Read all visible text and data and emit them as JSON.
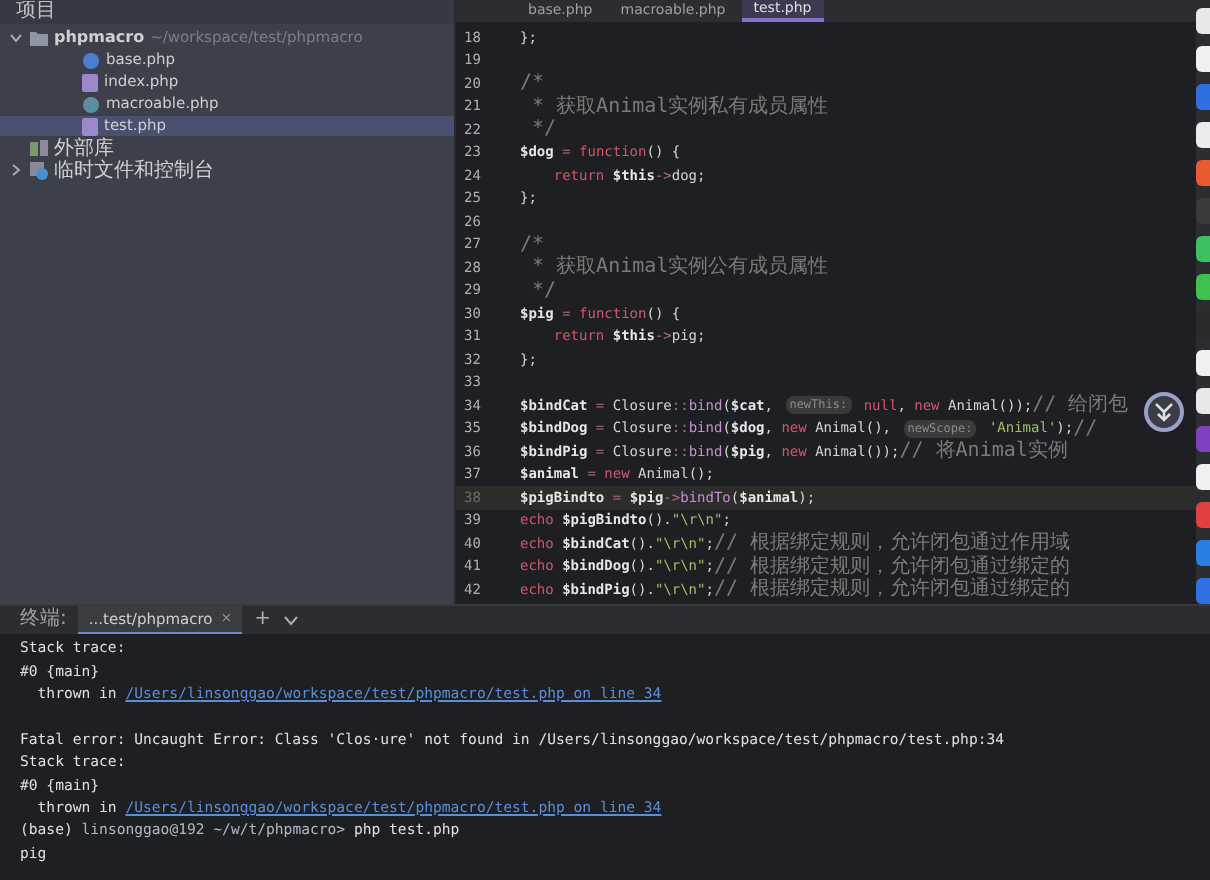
{
  "tool_window": {
    "title": "项目"
  },
  "project_tree": [
    {
      "label": "phpmacro",
      "path": "~/workspace/test/phpmacro",
      "kind": "folder",
      "expanded": true,
      "selected": false,
      "children": [
        {
          "label": "base.php",
          "kind": "class",
          "selected": false
        },
        {
          "label": "index.php",
          "kind": "php",
          "selected": false
        },
        {
          "label": "macroable.php",
          "kind": "trait",
          "selected": false
        },
        {
          "label": "test.php",
          "kind": "php",
          "selected": true
        }
      ]
    },
    {
      "label": "外部库",
      "kind": "library",
      "selected": false
    },
    {
      "label": "临时文件和控制台",
      "kind": "scratch",
      "expanded": false,
      "selected": false
    }
  ],
  "editor_tabs": [
    {
      "label": "base.php",
      "selected": false
    },
    {
      "label": "macroable.php",
      "selected": false
    },
    {
      "label": "test.php",
      "selected": true
    }
  ],
  "editor_lines": [
    {
      "number": "18",
      "current": false,
      "tokens": [
        {
          "kind": "p",
          "text": "};"
        }
      ]
    },
    {
      "number": "19",
      "current": false
    },
    {
      "number": "20",
      "current": false,
      "tokens": [
        {
          "kind": "c",
          "text": "/*"
        }
      ]
    },
    {
      "number": "21",
      "current": false,
      "tokens": [
        {
          "kind": "c",
          "text": " * 获取Animal实例私有成员属性"
        }
      ]
    },
    {
      "number": "22",
      "current": false,
      "tokens": [
        {
          "kind": "c",
          "text": " */"
        }
      ]
    },
    {
      "number": "23",
      "current": false,
      "tokens": [
        {
          "kind": "v",
          "text": "$dog"
        },
        {
          "kind": "o",
          "text": " = "
        },
        {
          "kind": "k",
          "text": "function"
        },
        {
          "kind": "p",
          "text": "() {"
        }
      ]
    },
    {
      "number": "24",
      "current": false,
      "tokens": [
        {
          "kind": "k",
          "text": "    return "
        },
        {
          "kind": "v",
          "text": "$this"
        },
        {
          "kind": "o",
          "text": "->"
        },
        {
          "kind": "p",
          "text": "dog;"
        }
      ]
    },
    {
      "number": "25",
      "current": false,
      "tokens": [
        {
          "kind": "p",
          "text": "};"
        }
      ]
    },
    {
      "number": "26",
      "current": false
    },
    {
      "number": "27",
      "current": false,
      "tokens": [
        {
          "kind": "c",
          "text": "/*"
        }
      ]
    },
    {
      "number": "28",
      "current": false,
      "tokens": [
        {
          "kind": "c",
          "text": " * 获取Animal实例公有成员属性"
        }
      ]
    },
    {
      "number": "29",
      "current": false,
      "tokens": [
        {
          "kind": "c",
          "text": " */"
        }
      ]
    },
    {
      "number": "30",
      "current": false,
      "tokens": [
        {
          "kind": "v",
          "text": "$pig"
        },
        {
          "kind": "o",
          "text": " = "
        },
        {
          "kind": "k",
          "text": "function"
        },
        {
          "kind": "p",
          "text": "() {"
        }
      ]
    },
    {
      "number": "31",
      "current": false,
      "tokens": [
        {
          "kind": "k",
          "text": "    return "
        },
        {
          "kind": "v",
          "text": "$this"
        },
        {
          "kind": "o",
          "text": "->"
        },
        {
          "kind": "p",
          "text": "pig;"
        }
      ]
    },
    {
      "number": "32",
      "current": false,
      "tokens": [
        {
          "kind": "p",
          "text": "};"
        }
      ]
    },
    {
      "number": "33",
      "current": false
    },
    {
      "number": "34",
      "current": false,
      "tokens": [
        {
          "kind": "v",
          "text": "$bindCat"
        },
        {
          "kind": "o",
          "text": " = "
        },
        {
          "kind": "p",
          "text": "Closure"
        },
        {
          "kind": "o",
          "text": "::"
        },
        {
          "kind": "f",
          "text": "bind"
        },
        {
          "kind": "p",
          "text": "("
        },
        {
          "kind": "v",
          "text": "$cat"
        },
        {
          "kind": "p",
          "text": ", "
        },
        {
          "kind": "h",
          "text": "newThis:"
        },
        {
          "kind": "k",
          "text": " null"
        },
        {
          "kind": "p",
          "text": ", "
        },
        {
          "kind": "k",
          "text": "new "
        },
        {
          "kind": "p",
          "text": "Animal());"
        },
        {
          "kind": "c",
          "text": "// 给闭包"
        }
      ]
    },
    {
      "number": "35",
      "current": false,
      "tokens": [
        {
          "kind": "v",
          "text": "$bindDog"
        },
        {
          "kind": "o",
          "text": " = "
        },
        {
          "kind": "p",
          "text": "Closure"
        },
        {
          "kind": "o",
          "text": "::"
        },
        {
          "kind": "f",
          "text": "bind"
        },
        {
          "kind": "p",
          "text": "("
        },
        {
          "kind": "v",
          "text": "$dog"
        },
        {
          "kind": "p",
          "text": ", "
        },
        {
          "kind": "k",
          "text": "new "
        },
        {
          "kind": "p",
          "text": "Animal(), "
        },
        {
          "kind": "h",
          "text": "newScope:"
        },
        {
          "kind": "s",
          "text": " 'Animal'"
        },
        {
          "kind": "p",
          "text": ");"
        },
        {
          "kind": "c",
          "text": "//"
        }
      ]
    },
    {
      "number": "36",
      "current": false,
      "tokens": [
        {
          "kind": "v",
          "text": "$bindPig"
        },
        {
          "kind": "o",
          "text": " = "
        },
        {
          "kind": "p",
          "text": "Closure"
        },
        {
          "kind": "o",
          "text": "::"
        },
        {
          "kind": "f",
          "text": "bind"
        },
        {
          "kind": "p",
          "text": "("
        },
        {
          "kind": "v",
          "text": "$pig"
        },
        {
          "kind": "p",
          "text": ", "
        },
        {
          "kind": "k",
          "text": "new "
        },
        {
          "kind": "p",
          "text": "Animal());"
        },
        {
          "kind": "c",
          "text": "// 将Animal实例"
        }
      ]
    },
    {
      "number": "37",
      "current": false,
      "tokens": [
        {
          "kind": "v",
          "text": "$animal"
        },
        {
          "kind": "o",
          "text": " = "
        },
        {
          "kind": "k",
          "text": "new "
        },
        {
          "kind": "p",
          "text": "Animal();"
        }
      ]
    },
    {
      "number": "38",
      "current": true,
      "tokens": [
        {
          "kind": "v",
          "text": "$pigBindto"
        },
        {
          "kind": "o",
          "text": " = "
        },
        {
          "kind": "v",
          "text": "$pig"
        },
        {
          "kind": "o",
          "text": "->"
        },
        {
          "kind": "f",
          "text": "bindTo"
        },
        {
          "kind": "p",
          "text": "("
        },
        {
          "kind": "v",
          "text": "$animal"
        },
        {
          "kind": "p",
          "text": ");"
        }
      ]
    },
    {
      "number": "39",
      "current": false,
      "tokens": [
        {
          "kind": "k",
          "text": "echo "
        },
        {
          "kind": "v",
          "text": "$pigBindto"
        },
        {
          "kind": "p",
          "text": "()."
        },
        {
          "kind": "s",
          "text": "\"\\r\\n\""
        },
        {
          "kind": "p",
          "text": ";"
        }
      ]
    },
    {
      "number": "40",
      "current": false,
      "tokens": [
        {
          "kind": "k",
          "text": "echo "
        },
        {
          "kind": "v",
          "text": "$bindCat"
        },
        {
          "kind": "p",
          "text": "()."
        },
        {
          "kind": "s",
          "text": "\"\\r\\n\""
        },
        {
          "kind": "p",
          "text": ";"
        },
        {
          "kind": "c",
          "text": "// 根据绑定规则，允许闭包通过作用域"
        }
      ]
    },
    {
      "number": "41",
      "current": false,
      "tokens": [
        {
          "kind": "k",
          "text": "echo "
        },
        {
          "kind": "v",
          "text": "$bindDog"
        },
        {
          "kind": "p",
          "text": "()."
        },
        {
          "kind": "s",
          "text": "\"\\r\\n\""
        },
        {
          "kind": "p",
          "text": ";"
        },
        {
          "kind": "c",
          "text": "// 根据绑定规则，允许闭包通过绑定的"
        }
      ]
    },
    {
      "number": "42",
      "current": false,
      "tokens": [
        {
          "kind": "k",
          "text": "echo "
        },
        {
          "kind": "v",
          "text": "$bindPig"
        },
        {
          "kind": "p",
          "text": "()."
        },
        {
          "kind": "s",
          "text": "\"\\r\\n\""
        },
        {
          "kind": "p",
          "text": ";"
        },
        {
          "kind": "c",
          "text": "// 根据绑定规则，允许闭包通过绑定的"
        }
      ]
    }
  ],
  "terminal": {
    "label": "终端:",
    "tabs": [
      {
        "label": "...test/phpmacro",
        "close": "×",
        "selected": true
      }
    ],
    "add": "+",
    "lines": [
      {
        "segments": [
          {
            "kind": "text",
            "text": "Stack trace:"
          }
        ]
      },
      {
        "segments": [
          {
            "kind": "text",
            "text": "#0 {main}"
          }
        ]
      },
      {
        "segments": [
          {
            "kind": "text",
            "text": "  thrown in "
          },
          {
            "kind": "link",
            "text": "/Users/linsonggao/workspace/test/phpmacro/test.php on line 34"
          }
        ]
      },
      {
        "gap_before": true,
        "segments": [
          {
            "kind": "text",
            "text": "Fatal error: Uncaught Error: Class 'Clos·ure' not found in /Users/linsonggao/workspace/test/phpmacro/test.php:34"
          }
        ]
      },
      {
        "segments": [
          {
            "kind": "text",
            "text": "Stack trace:"
          }
        ]
      },
      {
        "segments": [
          {
            "kind": "text",
            "text": "#0 {main}"
          }
        ]
      },
      {
        "segments": [
          {
            "kind": "text",
            "text": "  thrown in "
          },
          {
            "kind": "link",
            "text": "/Users/linsonggao/workspace/test/phpmacro/test.php on line 34"
          }
        ]
      },
      {
        "segments": [
          {
            "kind": "text",
            "text": "(base) "
          },
          {
            "kind": "prompt",
            "text": "linsonggao@192 ~/w/t/phpmacro>"
          },
          {
            "kind": "text",
            "text": " php test.php"
          }
        ]
      },
      {
        "segments": [
          {
            "kind": "text",
            "text": "pig"
          }
        ]
      }
    ]
  }
}
